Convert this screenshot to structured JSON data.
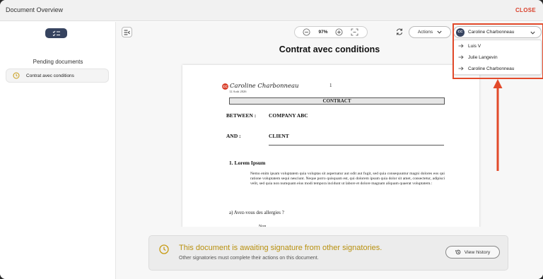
{
  "header": {
    "title": "Document Overview",
    "close_label": "CLOSE"
  },
  "sidebar": {
    "pending_title": "Pending documents",
    "items": [
      {
        "label": "Contrat avec conditions"
      }
    ]
  },
  "toolbar": {
    "zoom": "97%",
    "actions_label": "Actions",
    "user": {
      "initials": "CC",
      "name": "Caroline Charbonneau"
    }
  },
  "dropdown": {
    "items": [
      {
        "label": "Luis V"
      },
      {
        "label": "Julie Langevin"
      },
      {
        "label": "Caroline Charbonneau"
      }
    ]
  },
  "document": {
    "title": "Contrat avec conditions",
    "page_number": "1",
    "signature_initials": "CC",
    "signature_name": "Caroline Charbonneau",
    "signature_date": "12 Août 2026",
    "contract_label": "CONTRACT",
    "between_label": "BETWEEN :",
    "between_value": "COMPANY ABC",
    "and_label": "AND :",
    "and_value": "CLIENT",
    "section_title": "1. Lorem Ipsum",
    "paragraph": "Nemo enim ipsam voluptatem quia voluptas sit aspernatur aut odit aut fugit, sed quia consequuntur magni dolores eos qui ratione voluptatem sequi nesciunt. Neque porro quisquam est, qui dolorem ipsum quia dolor sit amet, consectetur, adipisci velit, sed quia non numquam eius modi tempora incidunt ut labore et dolore magnam aliquam quaerat voluptatem.:",
    "question": "a)   Avez-vous des allergies ?",
    "answer": "Non"
  },
  "banner": {
    "heading": "This document is awaiting signature from other signatories.",
    "subtext": "Other signatories must complete their actions on this document.",
    "history_label": "View history"
  },
  "colors": {
    "accent_red": "#e24a2a",
    "navy": "#36435f",
    "status_gold": "#b8900e"
  }
}
